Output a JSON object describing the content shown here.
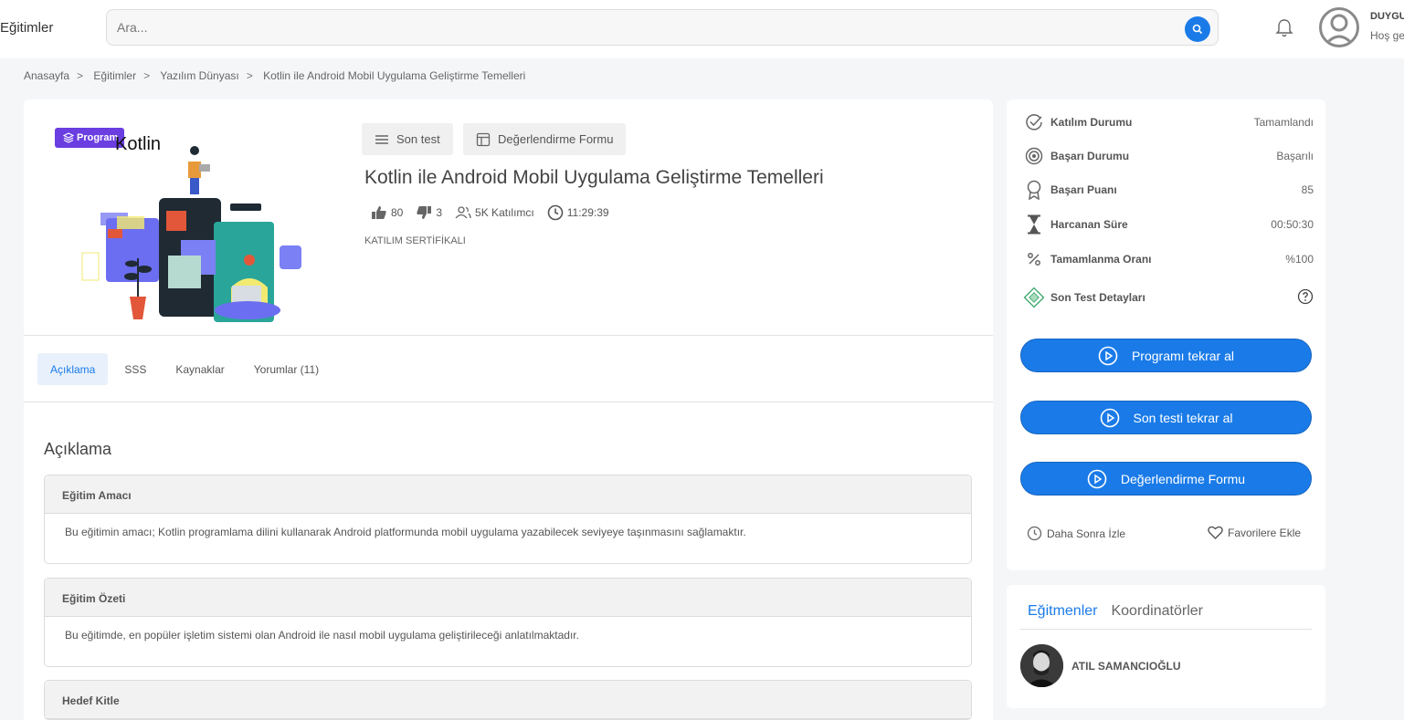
{
  "header": {
    "brand": "Eğitimler",
    "search_placeholder": "Ara...",
    "user_name": "DUYGU",
    "user_greeting": "Hoş ge"
  },
  "breadcrumb": [
    "Anasayfa",
    "Eğitimler",
    "Yazılım Dünyası",
    "Kotlin ile Android Mobil Uygulama Geliştirme Temelleri"
  ],
  "course": {
    "badge": "Program",
    "image_text": "Kotlin",
    "actions": [
      "Son test",
      "Değerlendirme Formu"
    ],
    "title": "Kotlin ile Android Mobil Uygulama Geliştirme Temelleri",
    "likes": "80",
    "dislikes": "3",
    "participants": "5K Katılımcı",
    "duration": "11:29:39",
    "certificate": "KATILIM SERTİFİKALI"
  },
  "tabs": [
    "Açıklama",
    "SSS",
    "Kaynaklar",
    "Yorumlar (11)"
  ],
  "description": {
    "title": "Açıklama",
    "sections": [
      {
        "heading": "Eğitim Amacı",
        "body": "Bu eğitimin amacı; Kotlin programlama dilini kullanarak Android platformunda mobil uygulama yazabilecek seviyeye taşınmasını sağlamaktır."
      },
      {
        "heading": "Eğitim Özeti",
        "body": "Bu eğitimde, en popüler işletim sistemi olan Android ile nasıl mobil uygulama geliştirileceği anlatılmaktadır."
      },
      {
        "heading": "Hedef Kitle",
        "body": ""
      }
    ]
  },
  "status": {
    "rows": [
      {
        "label": "Katılım Durumu",
        "value": "Tamamlandı"
      },
      {
        "label": "Başarı Durumu",
        "value": "Başarılı"
      },
      {
        "label": "Başarı Puanı",
        "value": "85"
      },
      {
        "label": "Harcanan Süre",
        "value": "00:50:30"
      },
      {
        "label": "Tamamlanma Oranı",
        "value": "%100"
      },
      {
        "label": "Son Test Detayları",
        "value": ""
      }
    ],
    "buttons": [
      "Programı tekrar al",
      "Son testi tekrar al",
      "Değerlendirme Formu"
    ],
    "watch_later": "Daha Sonra İzle",
    "favorite": "Favorilere Ekle"
  },
  "instructors": {
    "tabs": [
      "Eğitmenler",
      "Koordinatörler"
    ],
    "name": "ATIL SAMANCIOĞLU"
  },
  "colors": {
    "accent": "#1a7be8",
    "badge": "#6a3ee0"
  }
}
